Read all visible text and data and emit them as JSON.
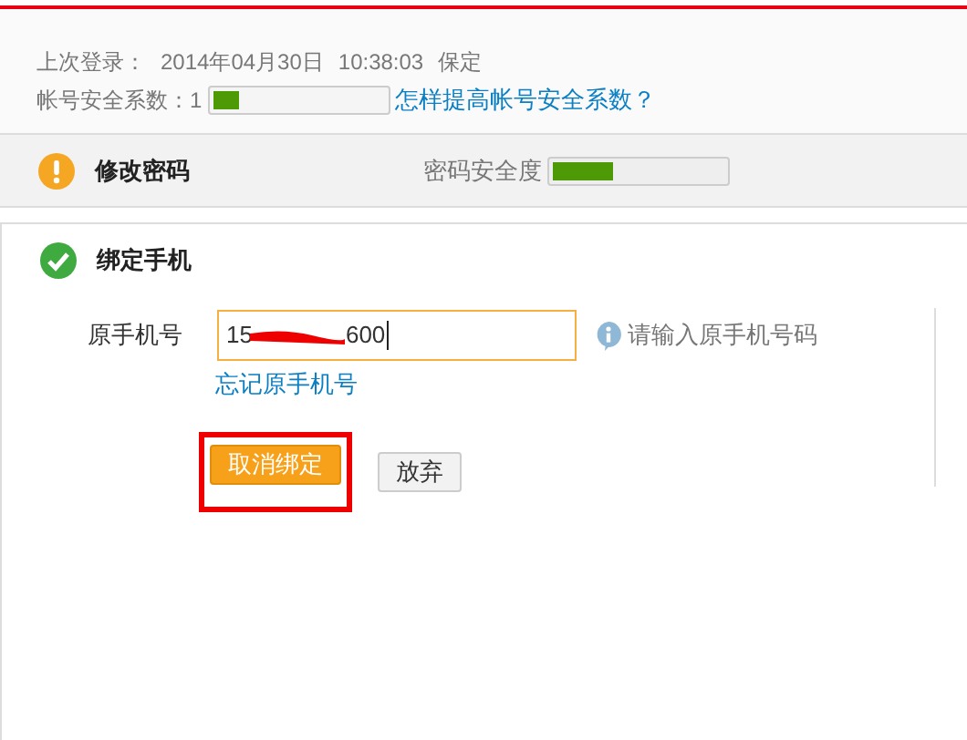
{
  "last_login": {
    "label": "上次登录：",
    "date": "2014年04月30日",
    "time": "10:38:03",
    "place": "保定"
  },
  "account_security": {
    "label": "帐号安全系数：1",
    "level": 0.15,
    "help_link": "怎样提高帐号安全系数？"
  },
  "change_password": {
    "title": "修改密码",
    "kind": "warning",
    "strength_label": "密码安全度",
    "level": 0.35
  },
  "bind_phone": {
    "title": "绑定手机",
    "kind": "ok",
    "field": {
      "label": "原手机号",
      "value_start": "15",
      "value_end": "600",
      "redacted": true,
      "hint": "请输入原手机号码"
    },
    "forgot_link": "忘记原手机号",
    "buttons": [
      {
        "label": "取消绑定",
        "kind": "primary",
        "highlighted": true
      },
      {
        "label": "放弃",
        "kind": "secondary",
        "highlighted": false
      }
    ]
  }
}
